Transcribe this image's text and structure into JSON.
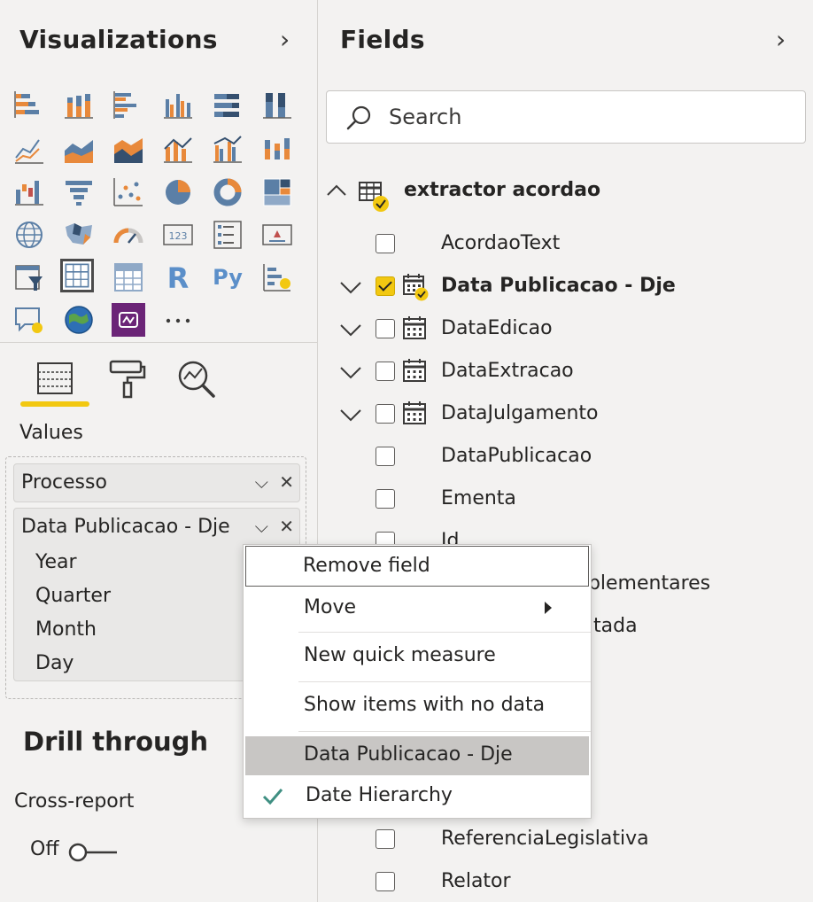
{
  "visualizations": {
    "title": "Visualizations",
    "tabs": [
      "fields-tab",
      "format-tab",
      "analytics-tab"
    ],
    "values_label": "Values",
    "well": {
      "fields": [
        {
          "label": "Processo"
        },
        {
          "label": "Data Publicacao - Dje",
          "hierarchy": [
            "Year",
            "Quarter",
            "Month",
            "Day"
          ]
        }
      ],
      "more_label": "⋯"
    },
    "drill_through": {
      "title": "Drill through",
      "cross_report_label": "Cross-report",
      "toggle_state": "Off"
    }
  },
  "fields": {
    "title": "Fields",
    "search": {
      "placeholder": "Search"
    },
    "table": {
      "name": "extractor acordao",
      "items": [
        {
          "name": "AcordaoText",
          "type": "text",
          "checked": false
        },
        {
          "name": "Data Publicacao - Dje",
          "type": "date-hierarchy",
          "checked": true,
          "expandable": true
        },
        {
          "name": "DataEdicao",
          "type": "date",
          "checked": false,
          "expandable": true
        },
        {
          "name": "DataExtracao",
          "type": "date",
          "checked": false,
          "expandable": true
        },
        {
          "name": "DataJulgamento",
          "type": "date",
          "checked": false,
          "expandable": true
        },
        {
          "name": "DataPublicacao",
          "type": "text",
          "checked": false
        },
        {
          "name": "Ementa",
          "type": "text",
          "checked": false
        },
        {
          "name": "Id",
          "type": "text",
          "checked": false
        },
        {
          "name": "InformacoesComplementares",
          "type": "text",
          "checked": false,
          "visible_part": "nplementares"
        },
        {
          "name": "Jurisprudencia Citada",
          "type": "text",
          "checked": false,
          "visible_part": "tada"
        },
        {
          "name": "ReferenciaLegislativa",
          "type": "text",
          "checked": false
        },
        {
          "name": "Relator",
          "type": "text",
          "checked": false
        }
      ]
    }
  },
  "context_menu": {
    "items": [
      {
        "label": "Remove field"
      },
      {
        "label": "Move"
      },
      {
        "label": "New quick measure"
      },
      {
        "label": "Show items with no data"
      },
      {
        "label": "Data Publicacao - Dje"
      },
      {
        "label": "Date Hierarchy"
      }
    ]
  },
  "colors": {
    "accent": "#f2c811",
    "highlight": "#c8c6c4",
    "checkmark": "#498205",
    "purple_visual": "#6b2477"
  }
}
